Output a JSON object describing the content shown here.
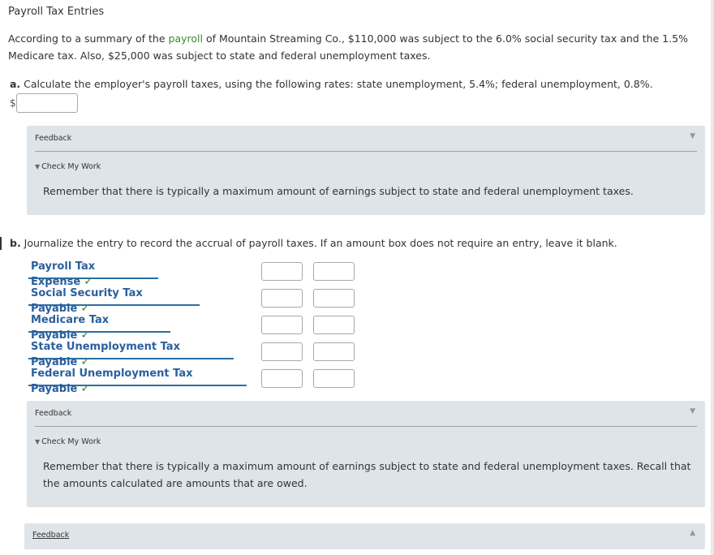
{
  "title": "Payroll Tax Entries",
  "intro": {
    "part1": "According to a summary of the ",
    "link": "payroll",
    "part2": " of Mountain Streaming Co., $110,000 was subject to the 6.0% social security tax and the 1.5% Medicare tax. Also, $25,000 was subject to state and federal unemployment taxes."
  },
  "question_a": {
    "label": "a.",
    "text": " Calculate the employer's payroll taxes, using the following rates: state unemployment, 5.4%; federal unemployment, 0.8%.",
    "currency": "$",
    "answer_value": ""
  },
  "feedback_a": {
    "header": "Feedback",
    "check_my_work": "Check My Work",
    "message": "Remember that there is typically a maximum amount of earnings subject to state and federal unemployment taxes."
  },
  "question_b": {
    "label": "b.",
    "text": " Journalize the entry to record the accrual of payroll taxes. If an amount box does not require an entry, leave it blank."
  },
  "journal_rows": [
    {
      "account": "Payroll Tax Expense",
      "debit": "",
      "credit": ""
    },
    {
      "account": "Social Security Tax Payable",
      "debit": "",
      "credit": ""
    },
    {
      "account": "Medicare Tax Payable",
      "debit": "",
      "credit": ""
    },
    {
      "account": "State Unemployment Tax Payable",
      "debit": "",
      "credit": ""
    },
    {
      "account": "Federal Unemployment Tax Payable",
      "debit": "",
      "credit": ""
    }
  ],
  "check_glyph": "✓",
  "feedback_b": {
    "header": "Feedback",
    "check_my_work": "Check My Work",
    "message": "Remember that there is typically a maximum amount of earnings subject to state and federal unemployment taxes. Recall that the amounts calculated are amounts that are owed."
  },
  "feedback_c": {
    "header": "Feedback"
  },
  "colors": {
    "link_green": "#3a8a2a",
    "account_blue": "#2b5f9e",
    "check_green": "#3c8a2e",
    "panel_bg": "#dfe4e8"
  }
}
